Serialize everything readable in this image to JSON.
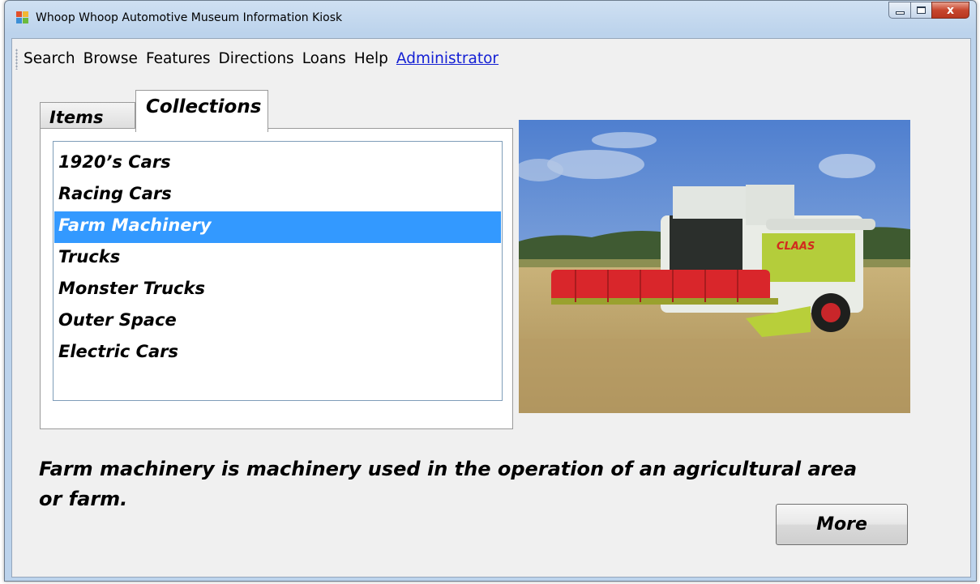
{
  "window": {
    "title": "Whoop Whoop Automotive Museum Information Kiosk",
    "icon": "app-window-icon",
    "controls": {
      "minimize": "minimize-icon",
      "maximize": "maximize-icon",
      "close": "close-icon",
      "close_glyph": "x"
    }
  },
  "menu": {
    "items": [
      "Search",
      "Browse",
      "Features",
      "Directions",
      "Loans",
      "Help"
    ],
    "admin_label": "Administrator",
    "admin_color": "#1420d4"
  },
  "tabs": {
    "items_label": "Items",
    "collections_label": "Collections",
    "active": "Collections"
  },
  "collections": {
    "list": [
      "1920’s Cars",
      "Racing Cars",
      "Farm Machinery",
      "Trucks",
      "Monster Trucks",
      "Outer Space",
      "Electric Cars"
    ],
    "selected": "Farm Machinery",
    "selection_color": "#3399ff"
  },
  "detail": {
    "image_subject": "combine-harvester-photo",
    "brand_on_image": "CLAAS",
    "description": "Farm machinery is machinery used in the operation of an agricultural area or farm.",
    "more_label": "More"
  }
}
